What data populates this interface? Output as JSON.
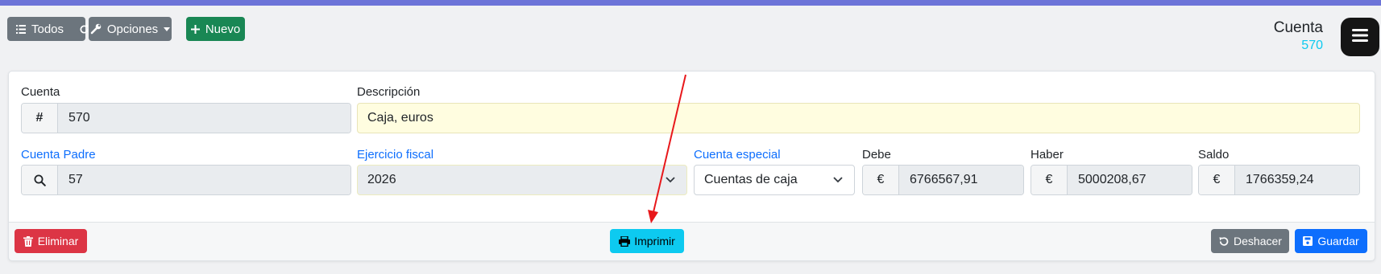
{
  "toolbar": {
    "all_label": "Todos",
    "options_label": "Opciones",
    "new_label": "Nuevo"
  },
  "header": {
    "title": "Cuenta",
    "subtitle": "570"
  },
  "form": {
    "cuenta": {
      "label": "Cuenta",
      "addon": "#",
      "value": "570"
    },
    "descripcion": {
      "label": "Descripción",
      "value": "Caja, euros"
    },
    "cuenta_padre": {
      "label": "Cuenta Padre",
      "value": "57"
    },
    "ejercicio": {
      "label": "Ejercicio fiscal",
      "value": "2026"
    },
    "cuenta_especial": {
      "label": "Cuenta especial",
      "value": "Cuentas de caja"
    },
    "debe": {
      "label": "Debe",
      "addon": "€",
      "value": "6766567,91"
    },
    "haber": {
      "label": "Haber",
      "addon": "€",
      "value": "5000208,67"
    },
    "saldo": {
      "label": "Saldo",
      "addon": "€",
      "value": "1766359,24"
    }
  },
  "footer": {
    "delete_label": "Eliminar",
    "print_label": "Imprimir",
    "undo_label": "Deshacer",
    "save_label": "Guardar"
  },
  "colors": {
    "accent_bar": "#6c74d8",
    "link": "#0d6efd",
    "subtitle": "#0dcaf0",
    "arrow": "#e8181b"
  },
  "icons": [
    "list-icon",
    "refresh-icon",
    "wrench-icon",
    "caret-down-icon",
    "plus-icon",
    "menu-icon",
    "search-icon",
    "chevron-down-icon",
    "trash-icon",
    "printer-icon",
    "undo-icon",
    "save-icon"
  ]
}
